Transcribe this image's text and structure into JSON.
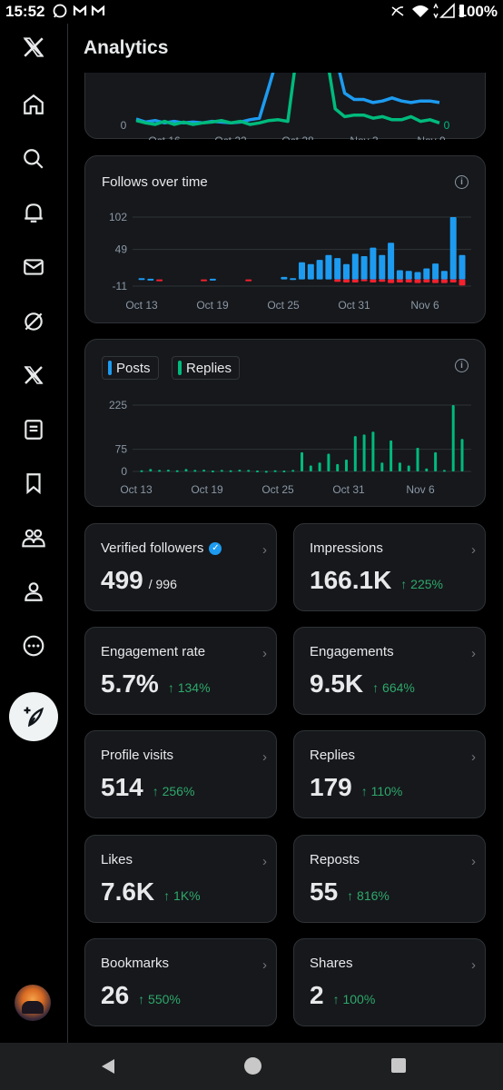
{
  "status_bar": {
    "time": "15:52",
    "battery": "100%"
  },
  "header": {
    "title": "Analytics"
  },
  "sidebar": {
    "items": [
      {
        "name": "x-logo-icon"
      },
      {
        "name": "home-icon"
      },
      {
        "name": "search-icon"
      },
      {
        "name": "notifications-icon"
      },
      {
        "name": "messages-icon"
      },
      {
        "name": "grok-icon"
      },
      {
        "name": "premium-x-icon"
      },
      {
        "name": "lists-icon"
      },
      {
        "name": "bookmarks-icon"
      },
      {
        "name": "communities-icon"
      },
      {
        "name": "profile-icon"
      },
      {
        "name": "more-icon"
      }
    ],
    "compose": "compose-icon"
  },
  "colors": {
    "blue": "#1d9bf0",
    "green": "#00ba7c",
    "red": "#f4212e",
    "positive_change": "#2ea86a"
  },
  "chart_data": [
    {
      "type": "line",
      "title": "",
      "x_ticks": [
        "Oct 16",
        "Oct 22",
        "Oct 28",
        "Nov 3",
        "Nov 9"
      ],
      "y_left_label": "0",
      "y_right_label": "0",
      "series": [
        {
          "color": "#1d9bf0",
          "values": [
            7,
            3,
            5,
            2,
            4,
            2,
            3,
            2,
            4,
            3,
            2,
            3,
            6,
            8,
            48,
            90,
            95,
            95,
            95,
            95,
            95,
            90,
            40,
            32,
            32,
            28,
            30,
            34,
            30,
            28,
            30,
            30,
            28
          ]
        },
        {
          "color": "#00ba7c",
          "values": [
            5,
            2,
            0,
            4,
            0,
            3,
            0,
            2,
            3,
            5,
            2,
            4,
            0,
            2,
            5,
            6,
            4,
            95,
            95,
            95,
            95,
            20,
            10,
            12,
            12,
            8,
            10,
            6,
            6,
            10,
            4,
            6,
            2
          ]
        }
      ]
    },
    {
      "type": "bar",
      "title": "Follows over time",
      "x_ticks": [
        "Oct 13",
        "Oct 19",
        "Oct 25",
        "Oct 31",
        "Nov 6"
      ],
      "y_ticks": [
        102,
        49,
        -11
      ],
      "ylim": [
        -11,
        102
      ],
      "series": [
        {
          "name": "Follows",
          "color": "#1d9bf0",
          "values": [
            2,
            1,
            0,
            0,
            0,
            0,
            0,
            0,
            1,
            0,
            0,
            0,
            0,
            0,
            0,
            0,
            4,
            2,
            28,
            25,
            32,
            40,
            35,
            25,
            42,
            38,
            52,
            40,
            60,
            15,
            14,
            12,
            18,
            26,
            14,
            102,
            40
          ]
        },
        {
          "name": "Unfollows",
          "color": "#f4212e",
          "values": [
            0,
            0,
            -1,
            0,
            0,
            0,
            0,
            -2,
            0,
            0,
            0,
            0,
            -2,
            0,
            0,
            0,
            0,
            0,
            0,
            0,
            0,
            0,
            -4,
            -5,
            -5,
            -3,
            -5,
            -4,
            -6,
            -5,
            -5,
            -6,
            -5,
            -6,
            -6,
            -5,
            -10
          ]
        }
      ]
    },
    {
      "type": "bar",
      "title": "",
      "legend": [
        "Posts",
        "Replies"
      ],
      "x_ticks": [
        "Oct 13",
        "Oct 19",
        "Oct 25",
        "Oct 31",
        "Nov 6"
      ],
      "y_ticks": [
        225,
        75,
        0
      ],
      "ylim": [
        0,
        225
      ],
      "series": [
        {
          "name": "Posts",
          "color": "#1d9bf0",
          "values": [
            0,
            0,
            0,
            0,
            0,
            0,
            0,
            0,
            0,
            0,
            0,
            0,
            0,
            0,
            0,
            0,
            0,
            0,
            0,
            0,
            0,
            0,
            0,
            0,
            0,
            0,
            0,
            0,
            0,
            0,
            0,
            0,
            0,
            0,
            0,
            0,
            0
          ]
        },
        {
          "name": "Replies",
          "color": "#00ba7c",
          "values": [
            4,
            8,
            5,
            6,
            4,
            8,
            5,
            6,
            3,
            5,
            4,
            6,
            5,
            3,
            2,
            4,
            3,
            5,
            65,
            20,
            30,
            60,
            25,
            40,
            120,
            125,
            135,
            30,
            105,
            30,
            20,
            80,
            10,
            65,
            5,
            225,
            110
          ]
        }
      ]
    }
  ],
  "stats": [
    {
      "label": "Verified followers",
      "value": "499",
      "sub": "/ 996",
      "change": ""
    },
    {
      "label": "Impressions",
      "value": "166.1K",
      "sub": "",
      "change": "↑ 225%"
    },
    {
      "label": "Engagement rate",
      "value": "5.7%",
      "sub": "",
      "change": "↑ 134%"
    },
    {
      "label": "Engagements",
      "value": "9.5K",
      "sub": "",
      "change": "↑ 664%"
    },
    {
      "label": "Profile visits",
      "value": "514",
      "sub": "",
      "change": "↑ 256%"
    },
    {
      "label": "Replies",
      "value": "179",
      "sub": "",
      "change": "↑ 110%"
    },
    {
      "label": "Likes",
      "value": "7.6K",
      "sub": "",
      "change": "↑ 1K%"
    },
    {
      "label": "Reposts",
      "value": "55",
      "sub": "",
      "change": "↑ 816%"
    },
    {
      "label": "Bookmarks",
      "value": "26",
      "sub": "",
      "change": "↑ 550%"
    },
    {
      "label": "Shares",
      "value": "2",
      "sub": "",
      "change": "↑ 100%"
    }
  ]
}
